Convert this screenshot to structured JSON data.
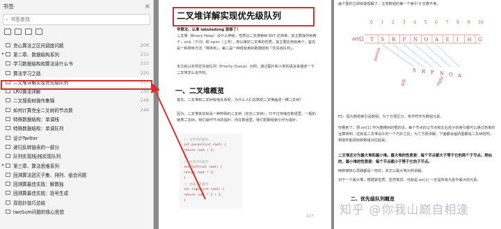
{
  "sidebar": {
    "title": "书签",
    "search_placeholder": "书签查找",
    "items": [
      {
        "label": "贪心算法之区间调度问题",
        "page": "208",
        "arrow": ""
      },
      {
        "label": "第二章、数据结构系列",
        "page": "212",
        "arrow": "▾"
      },
      {
        "label": "学习数据结构和算法读什么书",
        "page": "215",
        "arrow": ""
      },
      {
        "label": "算法学习之路",
        "page": "220",
        "arrow": ""
      },
      {
        "label": "二叉堆详解实现优先级队列",
        "page": "227",
        "arrow": ""
      },
      {
        "label": "LRU算法详解",
        "page": "235",
        "arrow": ""
      },
      {
        "label": "二叉搜索树操作集锦",
        "page": "248",
        "arrow": ""
      },
      {
        "label": "如何计算完全二叉树的节点数",
        "page": "248",
        "arrow": ""
      },
      {
        "label": "特殊数据结构：单调栈",
        "page": "",
        "arrow": ""
      },
      {
        "label": "特殊数据结构：单调队列",
        "page": "",
        "arrow": ""
      },
      {
        "label": "设计Twitter",
        "page": "",
        "arrow": ""
      },
      {
        "label": "递归反转链表的一部分",
        "page": "",
        "arrow": ""
      },
      {
        "label": "队列实现栈|栈实现队列",
        "page": "",
        "arrow": ""
      },
      {
        "label": "第三章、算法思维系列",
        "page": "",
        "arrow": "▾"
      },
      {
        "label": "回溯算法团灭子集、排列、组合问题",
        "page": "",
        "arrow": ""
      },
      {
        "label": "回溯算最佳实践：解数独",
        "page": "",
        "arrow": ""
      },
      {
        "label": "回溯算最佳实践：括号生成",
        "page": "",
        "arrow": ""
      },
      {
        "label": "双指针技巧总结",
        "page": "",
        "arrow": ""
      },
      {
        "label": "twoSum问题的核心思想",
        "page": "",
        "arrow": ""
      }
    ]
  },
  "page": {
    "title": "二叉堆详解实现优先级队列",
    "byline": "学算法，认准 labuladong 就够了！",
    "p1": "二叉堆（Binary Heap）没什么神秘，性质比二叉搜索树 BST 还简单。其主要操作就两个，sink（下沉）和 swim（上浮），用以维护二叉堆的性质。其主要应用有两个，首先是一种排序方法「堆排序」，第二是一种很有用的数据结构「优先级队列」。",
    "p2": "本文就以实现优先级队列（Priority Queue）为例，通过图片和人类的语言来描述一下二叉堆怎么运作的。",
    "h2": "一、二叉堆概览",
    "p3": "首先，二叉堆和二叉树有啥关系呢，为什么人们总数把二叉堆画成一棵二叉树？",
    "p4": "因为，二叉堆其实就是一种特殊的二叉树（完全二叉树），只不过存储在数组里。一般的链表二叉树，我们操作节点的指针，而在数组里，我们把数组索引作为指针：",
    "code": [
      "// 父节点的索引",
      "int parent(int root) {",
      "    return root / 2;",
      "}",
      "// 左孩子的索引",
      "int left(int root) {",
      "    return root * 2;",
      "}",
      "// 右孩子的索引",
      "int right(int root) {",
      "    return root * 2 + 1;",
      "}"
    ],
    "page_num": "227"
  },
  "page2": {
    "top_text": "画个图你立即就能理解了，注意数组的第一个索引 0 空着不用，",
    "diagram": {
      "indices": [
        "0",
        "1",
        "2",
        "3",
        "4",
        "5",
        "6",
        "7",
        "8",
        "9",
        "10"
      ],
      "cells": [
        "T",
        "S",
        "R",
        "P",
        "N",
        "O",
        "A",
        "E",
        "I",
        "H",
        "G"
      ],
      "array_label": "arr[]",
      "labels": [
        "parent",
        "left",
        "right"
      ]
    },
    "ps": "PS：因为数组索引是数组，为了方便区分，将字符作为数组元素。",
    "t1": "你看到了，把 arr[1] 作为整棵树的根的话，每个节点的父节点和左右孩子的索引都可以通过简单的运算得到，这就是二叉堆设计的一个巧妙之处。为了方便讲解，下面都会画的图都是二叉树结构，相信你能把树和数组对应起来。",
    "t2": "二叉堆还分为最大堆和最小堆。最大堆的性质是：每个节点都大于等于它的两个子节点。类似的，最小堆的性质是：每个节点都小于等于它的子节点。",
    "t3": "两种堆核心思路都是一样的，本文以最大堆为例讲解。",
    "t4": "对于一个最大堆，根据其性质，显然堆顶，也就是 arr[1] 一定是所有元素中最大的元素。",
    "sub": "二、优先级队列概览",
    "watermark": "知乎 @你我山巅自相逢"
  },
  "colors": {
    "highlight": "#e02b2b",
    "diagram": "#cc4444"
  }
}
